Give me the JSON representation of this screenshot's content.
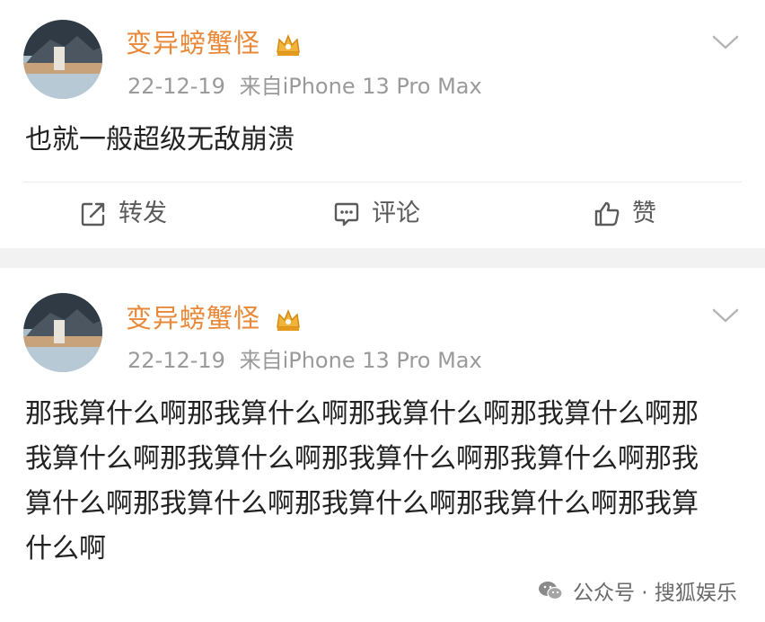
{
  "posts": [
    {
      "username": "变异螃蟹怪",
      "date": "22-12-19",
      "source": "来自iPhone 13 Pro Max",
      "text": "也就一般超级无敌崩溃",
      "actions": {
        "repost": "转发",
        "comment": "评论",
        "like": "赞"
      }
    },
    {
      "username": "变异螃蟹怪",
      "date": "22-12-19",
      "source": "来自iPhone 13 Pro Max",
      "text": "那我算什么啊那我算什么啊那我算什么啊那我算什么啊那我算什么啊那我算什么啊那我算什么啊那我算什么啊那我算什么啊那我算什么啊那我算什么啊那我算什么啊那我算什么啊"
    }
  ],
  "watermark": "公众号 · 搜狐娱乐",
  "colors": {
    "username": "#e8893a",
    "meta": "#9a9a9a",
    "text": "#222222",
    "separator": "#f2f2f2"
  },
  "icons": [
    "avatar",
    "crown-icon",
    "chevron-down-icon",
    "repost-icon",
    "comment-icon",
    "like-icon",
    "wechat-icon"
  ]
}
